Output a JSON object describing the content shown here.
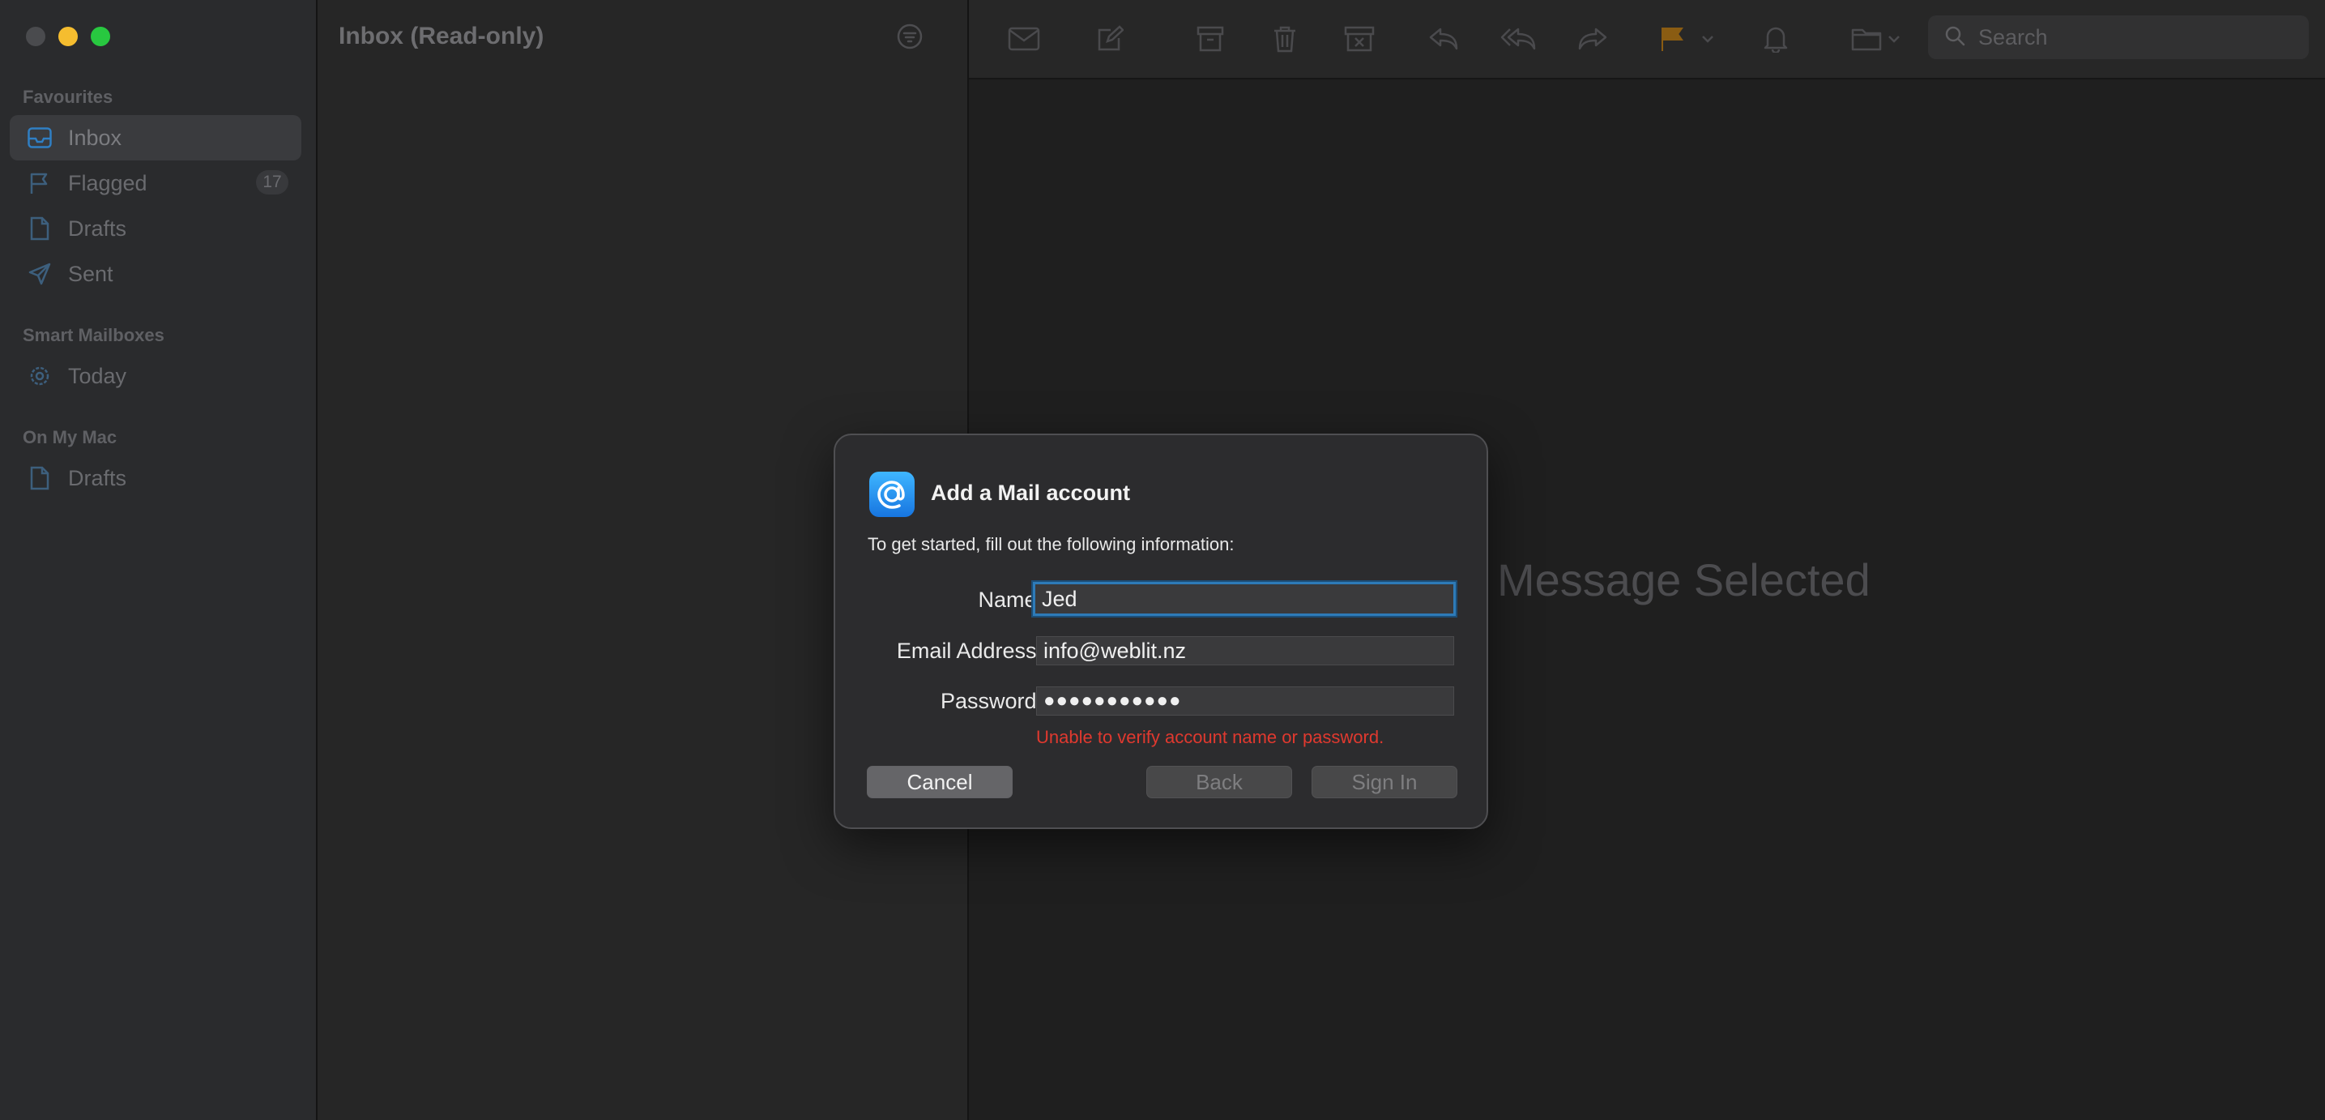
{
  "window": {
    "controls": {
      "close_color": "#4a4b4e",
      "minimize_color": "#f5bd2f",
      "zoom_color": "#28c840"
    }
  },
  "sidebar": {
    "favourites_title": "Favourites",
    "items": [
      {
        "label": "Inbox",
        "icon": "inbox-icon",
        "selected": true
      },
      {
        "label": "Flagged",
        "icon": "flag-icon",
        "badge": "17"
      },
      {
        "label": "Drafts",
        "icon": "document-icon"
      },
      {
        "label": "Sent",
        "icon": "paper-plane-icon"
      }
    ],
    "smart_title": "Smart Mailboxes",
    "smart_items": [
      {
        "label": "Today",
        "icon": "gear-icon"
      }
    ],
    "mac_title": "On My Mac",
    "mac_items": [
      {
        "label": "Drafts",
        "icon": "document-icon"
      }
    ]
  },
  "message_list": {
    "title": "Inbox (Read-only)",
    "filter_icon": "filter-icon"
  },
  "toolbar": {
    "icons": [
      "envelope-icon",
      "compose-icon",
      "archive-icon",
      "trash-icon",
      "junk-icon",
      "reply-icon",
      "reply-all-icon",
      "forward-icon",
      "flag-icon",
      "bell-icon",
      "move-folder-icon"
    ],
    "flag_color": "#f5a623",
    "search_placeholder": "Search"
  },
  "viewer": {
    "empty_text": "Message Selected"
  },
  "dialog": {
    "title": "Add a Mail account",
    "subtitle": "To get started, fill out the following information:",
    "name_label": "Name:",
    "name_value": "Jed",
    "email_label": "Email Address:",
    "email_value": "info@weblit.nz",
    "password_label": "Password:",
    "password_mask": "●●●●●●●●●●●",
    "error": "Unable to verify account name or password.",
    "error_color": "#e0392f",
    "cancel_label": "Cancel",
    "back_label": "Back",
    "signin_label": "Sign In",
    "focus_color": "#2e7bb8"
  }
}
